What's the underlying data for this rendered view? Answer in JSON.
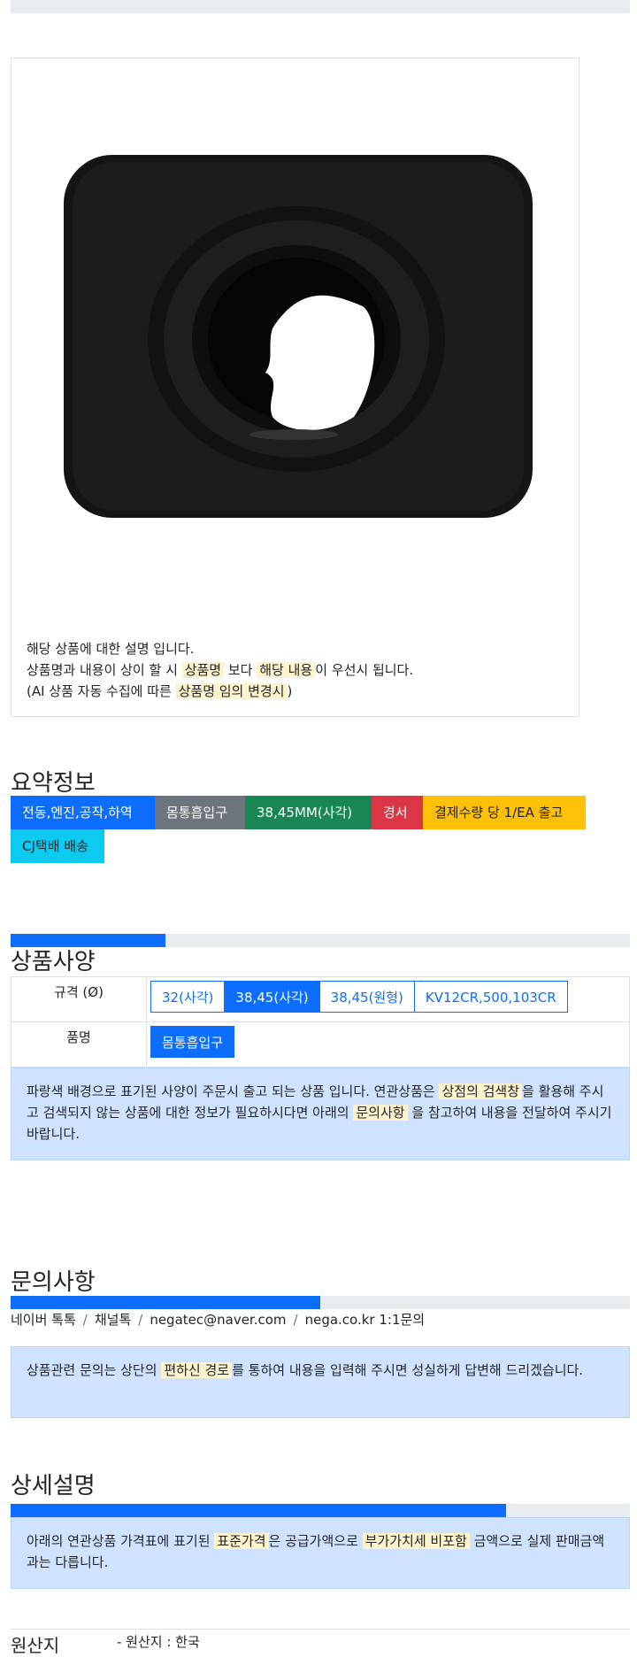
{
  "description": {
    "line1": "해당 상품에 대한 설명 입니다.",
    "line2_pre": "상품명과 내용이 상이 할 시",
    "line2_hl1": "상품명",
    "line2_mid": "보다",
    "line2_hl2": "해당 내용",
    "line2_post": "이 우선시 됩니다.",
    "line3_pre": "(AI 상품 자동 수집에 따른",
    "line3_hl": "상품명 임의 변경시",
    "line3_post": ")"
  },
  "summary": {
    "title": "요약정보",
    "tags": [
      {
        "label": "전동,엔진,공작,하역",
        "color": "#0d6efd"
      },
      {
        "label": "몸통흡입구",
        "color": "#6c757d"
      },
      {
        "label": "38,45MM(사각)",
        "color": "#198754"
      },
      {
        "label": "경서",
        "color": "#dc3545"
      },
      {
        "label": "결제수량 당 1/EA 출고",
        "color": "#ffc107"
      },
      {
        "label": "CJ택배 배송",
        "color": "#0dcaf0"
      }
    ]
  },
  "spec": {
    "title": "상품사양",
    "progress": 0.25,
    "row1_label": "규격 (Ø)",
    "options": [
      "32(사각)",
      "38,45(사각)",
      "38,45(원형)",
      "KV12CR,500,103CR"
    ],
    "selected_option": "38,45(사각)",
    "row2_label": "품명",
    "name_value": "몸통흡입구",
    "notice_pre": "파랑색 배경으로 표기된 사양이 주문시 출고 되는 상품 입니다. 연관상품은",
    "notice_hl1": "상점의 검색창",
    "notice_mid": "을 활용해 주시고 검색되지 않는 상품에 대한 정보가 필요하시다면 아래의",
    "notice_hl2": "문의사항",
    "notice_post": "을 참고하여 내용을 전달하여 주시기 바랍니다."
  },
  "inquiry": {
    "title": "문의사항",
    "progress": 0.5,
    "channels": [
      "네이버 톡톡",
      "채널톡",
      "negatec@naver.com",
      "nega.co.kr 1:1문의"
    ],
    "notice_pre": "상품관련 문의는 상단의",
    "notice_hl": "편하신 경로",
    "notice_post": "를 통하여 내용을 입력해 주시면 성실하게 답변해 드리겠습니다."
  },
  "detail": {
    "title": "상세설명",
    "progress": 0.8,
    "notice_pre": "아래의 연관상품 가격표에 표기된",
    "notice_hl1": "표준가격",
    "notice_mid": "은 공급가액으로",
    "notice_hl2": "부가가치세 비포함",
    "notice_post": "금액으로 실제 판매금액과는 다릅니다."
  },
  "origin": {
    "title": "원산지",
    "value": "- 원산지 : 한국"
  }
}
